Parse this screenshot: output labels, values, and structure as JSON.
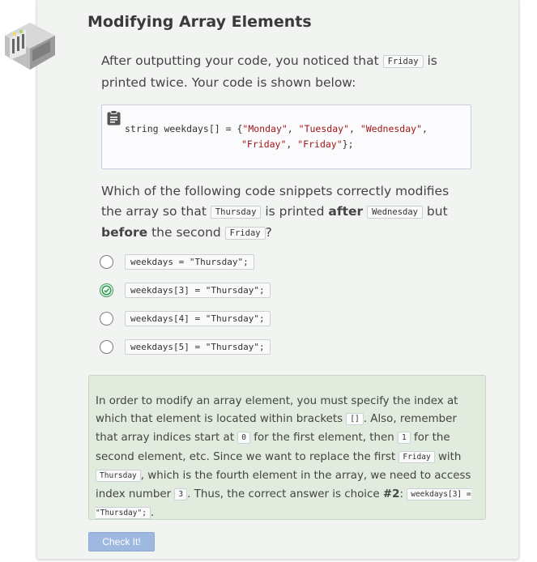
{
  "title": "Modifying Array Elements",
  "intro": {
    "before": "After outputting your code, you noticed that ",
    "code": "Friday",
    "after": " is printed twice. Your code is shown below:"
  },
  "code_lines": {
    "line1_prefix": "string weekdays[] = {",
    "line1_s1": "\"Monday\"",
    "line1_s2": "\"Tuesday\"",
    "line1_s3": "\"Wednesday\"",
    "line2_s1": "\"Friday\"",
    "line2_s2": "\"Friday\"",
    "line2_suffix": "};",
    "sep": ", "
  },
  "question": {
    "p1": "Which of the following code snippets correctly modifies the array so that ",
    "c1": "Thursday",
    "p2": " is printed ",
    "b1": "after",
    "c2": "Wednesday",
    "p3": " but ",
    "b2": "before",
    "p4": " the second ",
    "c3": "Friday",
    "p5": "?"
  },
  "options": [
    {
      "code": "weekdays = \"Thursday\";",
      "selected": false
    },
    {
      "code": "weekdays[3] = \"Thursday\";",
      "selected": true
    },
    {
      "code": "weekdays[4] = \"Thursday\";",
      "selected": false
    },
    {
      "code": "weekdays[5] = \"Thursday\";",
      "selected": false
    }
  ],
  "explanation": {
    "t1": "In order to modify an array element, you must specify the index at which that element is located within brackets ",
    "c1": "[]",
    "t2": ". Also, remember that array indices start at ",
    "c2": "0",
    "t3": " for the first element, then ",
    "c3": "1",
    "t4": " for the second element, etc. Since we want to replace the first ",
    "c4": "Friday",
    "t5": " with ",
    "c5": "Thursday",
    "t6": ", which is the fourth element in the array, we need to access index number ",
    "c6": "3",
    "t7": ". Thus, the correct answer is choice ",
    "b1": "#2",
    "t8": ": ",
    "c7": "weekdays[3] = \"Thursday\";",
    "t9": "."
  },
  "check_button": "Check It!",
  "colors": {
    "card_bg": "#f1f4f1",
    "explain_bg": "#e1ebde",
    "correct_green": "#3a9b57",
    "button_blue": "#9fb8e0",
    "string_red": "#a31515"
  },
  "icons": {
    "logo": "server-rack-logo-icon",
    "copy": "clipboard-icon",
    "checked": "check-circle-icon"
  }
}
